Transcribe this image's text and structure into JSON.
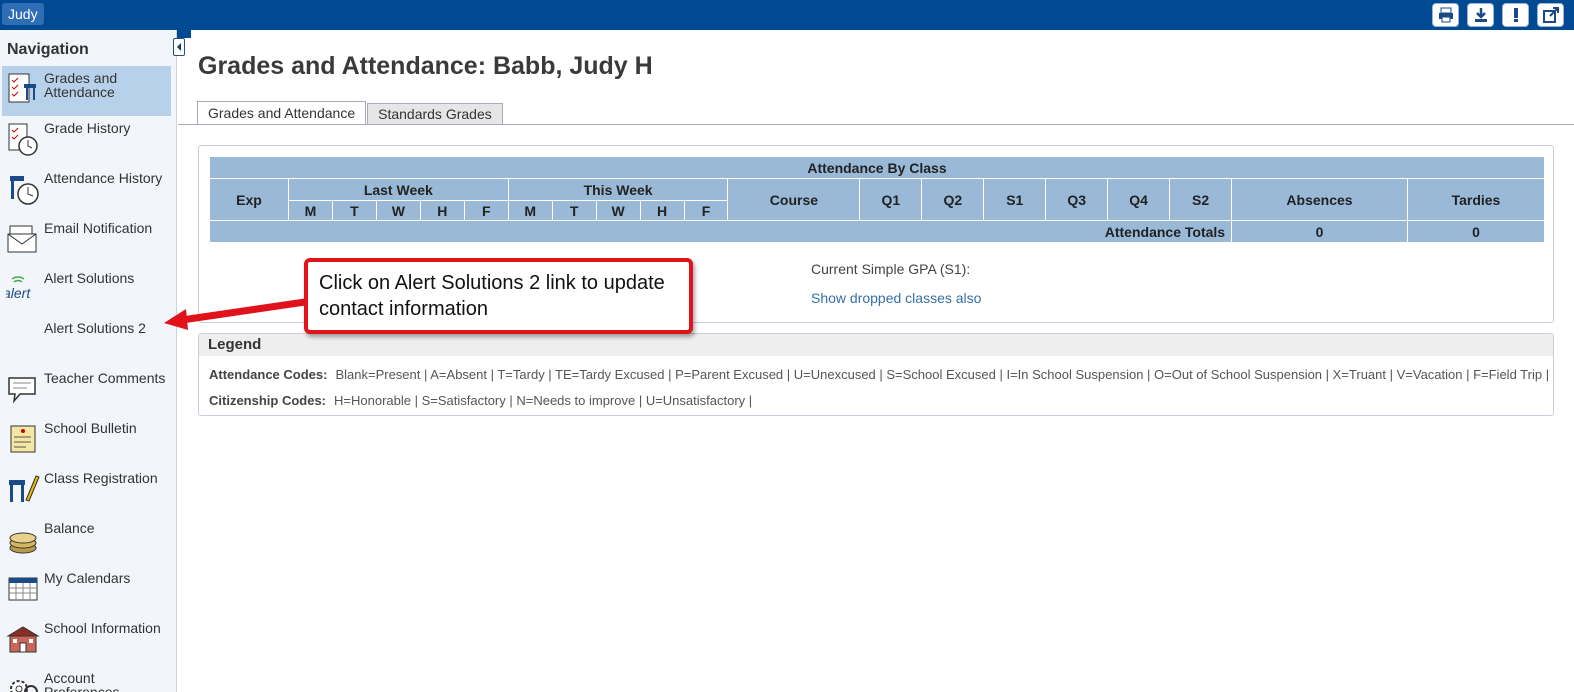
{
  "header": {
    "user": "Judy",
    "icons": [
      "printer-icon",
      "download-icon",
      "alert-icon",
      "external-link-icon"
    ]
  },
  "sidebar": {
    "title": "Navigation",
    "items": [
      {
        "label": "Grades and Attendance",
        "icon": "grades-icon",
        "active": true
      },
      {
        "label": "Grade History",
        "icon": "grade-history-icon"
      },
      {
        "label": "Attendance History",
        "icon": "attendance-history-icon"
      },
      {
        "label": "Email Notification",
        "icon": "email-icon"
      },
      {
        "label": "Alert Solutions",
        "icon": "alert-logo-icon"
      },
      {
        "label": "Alert Solutions 2",
        "icon": ""
      },
      {
        "label": "Teacher Comments",
        "icon": "comment-icon"
      },
      {
        "label": "School Bulletin",
        "icon": "bulletin-icon"
      },
      {
        "label": "Class Registration",
        "icon": "registration-icon"
      },
      {
        "label": "Balance",
        "icon": "coins-icon"
      },
      {
        "label": "My Calendars",
        "icon": "calendar-icon"
      },
      {
        "label": "School Information",
        "icon": "school-icon"
      },
      {
        "label": "Account Preferences",
        "icon": "preferences-icon"
      }
    ]
  },
  "main": {
    "title": "Grades and Attendance: Babb, Judy H",
    "tabs": [
      {
        "label": "Grades and Attendance",
        "active": true
      },
      {
        "label": "Standards Grades",
        "active": false
      }
    ],
    "attendance_table": {
      "caption": "Attendance By Class",
      "col_exp": "Exp",
      "last_week": "Last Week",
      "this_week": "This Week",
      "days": [
        "M",
        "T",
        "W",
        "H",
        "F"
      ],
      "col_course": "Course",
      "terms": [
        "Q1",
        "Q2",
        "S1",
        "Q3",
        "Q4",
        "S2"
      ],
      "col_absences": "Absences",
      "col_tardies": "Tardies",
      "totals_label": "Attendance Totals",
      "absences_total": "0",
      "tardies_total": "0"
    },
    "gpa_label": "Current Simple GPA (S1):",
    "dropped_link": "Show dropped classes also",
    "legend": {
      "title": "Legend",
      "attendance_label": "Attendance Codes:",
      "attendance_codes": "Blank=Present | A=Absent | T=Tardy | TE=Tardy Excused | P=Parent Excused | U=Unexcused | S=School Excused | I=In School Suspension | O=Out of School Suspension | X=Truant | V=Vacation | F=Field Trip |",
      "citizenship_label": "Citizenship Codes:",
      "citizenship_codes": "H=Honorable | S=Satisfactory | N=Needs to improve | U=Unsatisfactory |"
    }
  },
  "callout": {
    "text": "Click on Alert Solutions 2 link to update contact information"
  },
  "colors": {
    "topbar": "#004a94",
    "table_header": "#99b9d7",
    "callout_border": "#e0131a",
    "link": "#3770a8"
  }
}
